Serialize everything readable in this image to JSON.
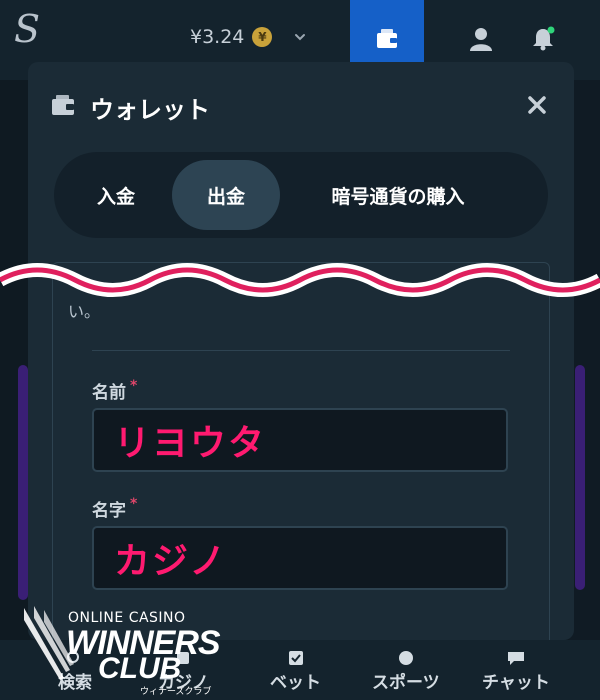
{
  "header": {
    "brand_logo": "S",
    "balance": "¥3.24",
    "currency_symbol": "¥"
  },
  "wallet_modal": {
    "title": "ウォレット",
    "tabs": [
      {
        "label": "入金",
        "active": false
      },
      {
        "label": "出金",
        "active": true
      },
      {
        "label": "暗号通貨の購入",
        "active": false
      }
    ],
    "partial_text": "い。",
    "fields": [
      {
        "label": "名前",
        "required_mark": "*",
        "value": "リヨウタ"
      },
      {
        "label": "名字",
        "required_mark": "*",
        "value": "カジノ"
      }
    ]
  },
  "bottom_nav": {
    "items": [
      {
        "label": "検索"
      },
      {
        "label": "カジノ"
      },
      {
        "label": "ベット"
      },
      {
        "label": "スポーツ"
      },
      {
        "label": "チャット"
      }
    ]
  },
  "watermark": {
    "line1": "ONLINE CASINO",
    "line2": "WINNERS",
    "line3": "CLUB",
    "line4": "ウィナーズクラブ"
  },
  "colors": {
    "accent_blue": "#1560c8",
    "annotation_pink": "#ff1a70",
    "wave_pink": "#e0205e",
    "required_red": "#e0466a"
  }
}
